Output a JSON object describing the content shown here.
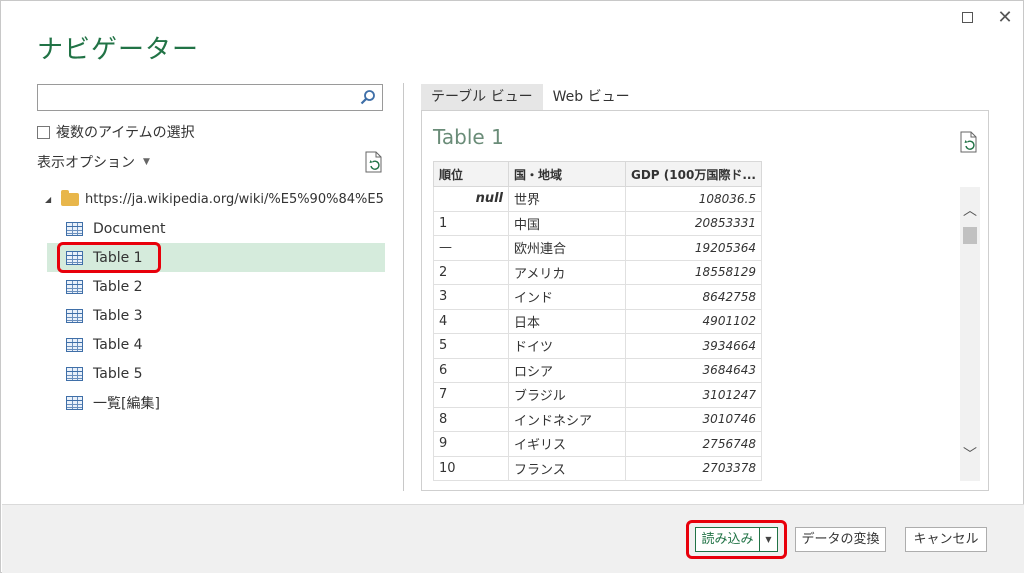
{
  "window": {
    "title": "ナビゲーター",
    "maximize_icon": "maximize-icon",
    "close_glyph": "✕"
  },
  "left_pane": {
    "search": {
      "value": "",
      "placeholder": ""
    },
    "multi_select_label": "複数のアイテムの選択",
    "display_options_label": "表示オプション",
    "tree": {
      "root_url": "https://ja.wikipedia.org/wiki/%E5%90%84%E5...",
      "items": [
        {
          "label": "Document",
          "selected": false
        },
        {
          "label": "Table 1",
          "selected": true
        },
        {
          "label": "Table 2",
          "selected": false
        },
        {
          "label": "Table 3",
          "selected": false
        },
        {
          "label": "Table 4",
          "selected": false
        },
        {
          "label": "Table 5",
          "selected": false
        },
        {
          "label": "一覧[編集]",
          "selected": false
        }
      ]
    }
  },
  "right_pane": {
    "tabs": [
      {
        "label": "テーブル ビュー",
        "active": true
      },
      {
        "label": "Web ビュー",
        "active": false
      }
    ],
    "preview_title": "Table 1",
    "table": {
      "headers": [
        "順位",
        "国・地域",
        "GDP (100万国際ド..."
      ],
      "rows": [
        [
          "null",
          "世界",
          "108036.5"
        ],
        [
          "1",
          "中国",
          "20853331"
        ],
        [
          "—",
          "欧州連合",
          "19205364"
        ],
        [
          "2",
          "アメリカ",
          "18558129"
        ],
        [
          "3",
          "インド",
          "8642758"
        ],
        [
          "4",
          "日本",
          "4901102"
        ],
        [
          "5",
          "ドイツ",
          "3934664"
        ],
        [
          "6",
          "ロシア",
          "3684643"
        ],
        [
          "7",
          "ブラジル",
          "3101247"
        ],
        [
          "8",
          "インドネシア",
          "3010746"
        ],
        [
          "9",
          "イギリス",
          "2756748"
        ],
        [
          "10",
          "フランス",
          "2703378"
        ]
      ]
    }
  },
  "footer": {
    "load_label": "読み込み",
    "transform_label": "データの変換",
    "cancel_label": "キャンセル"
  },
  "colors": {
    "accent": "#217346",
    "selected_row": "#d5ebdc",
    "highlight_box": "#e8000b"
  }
}
